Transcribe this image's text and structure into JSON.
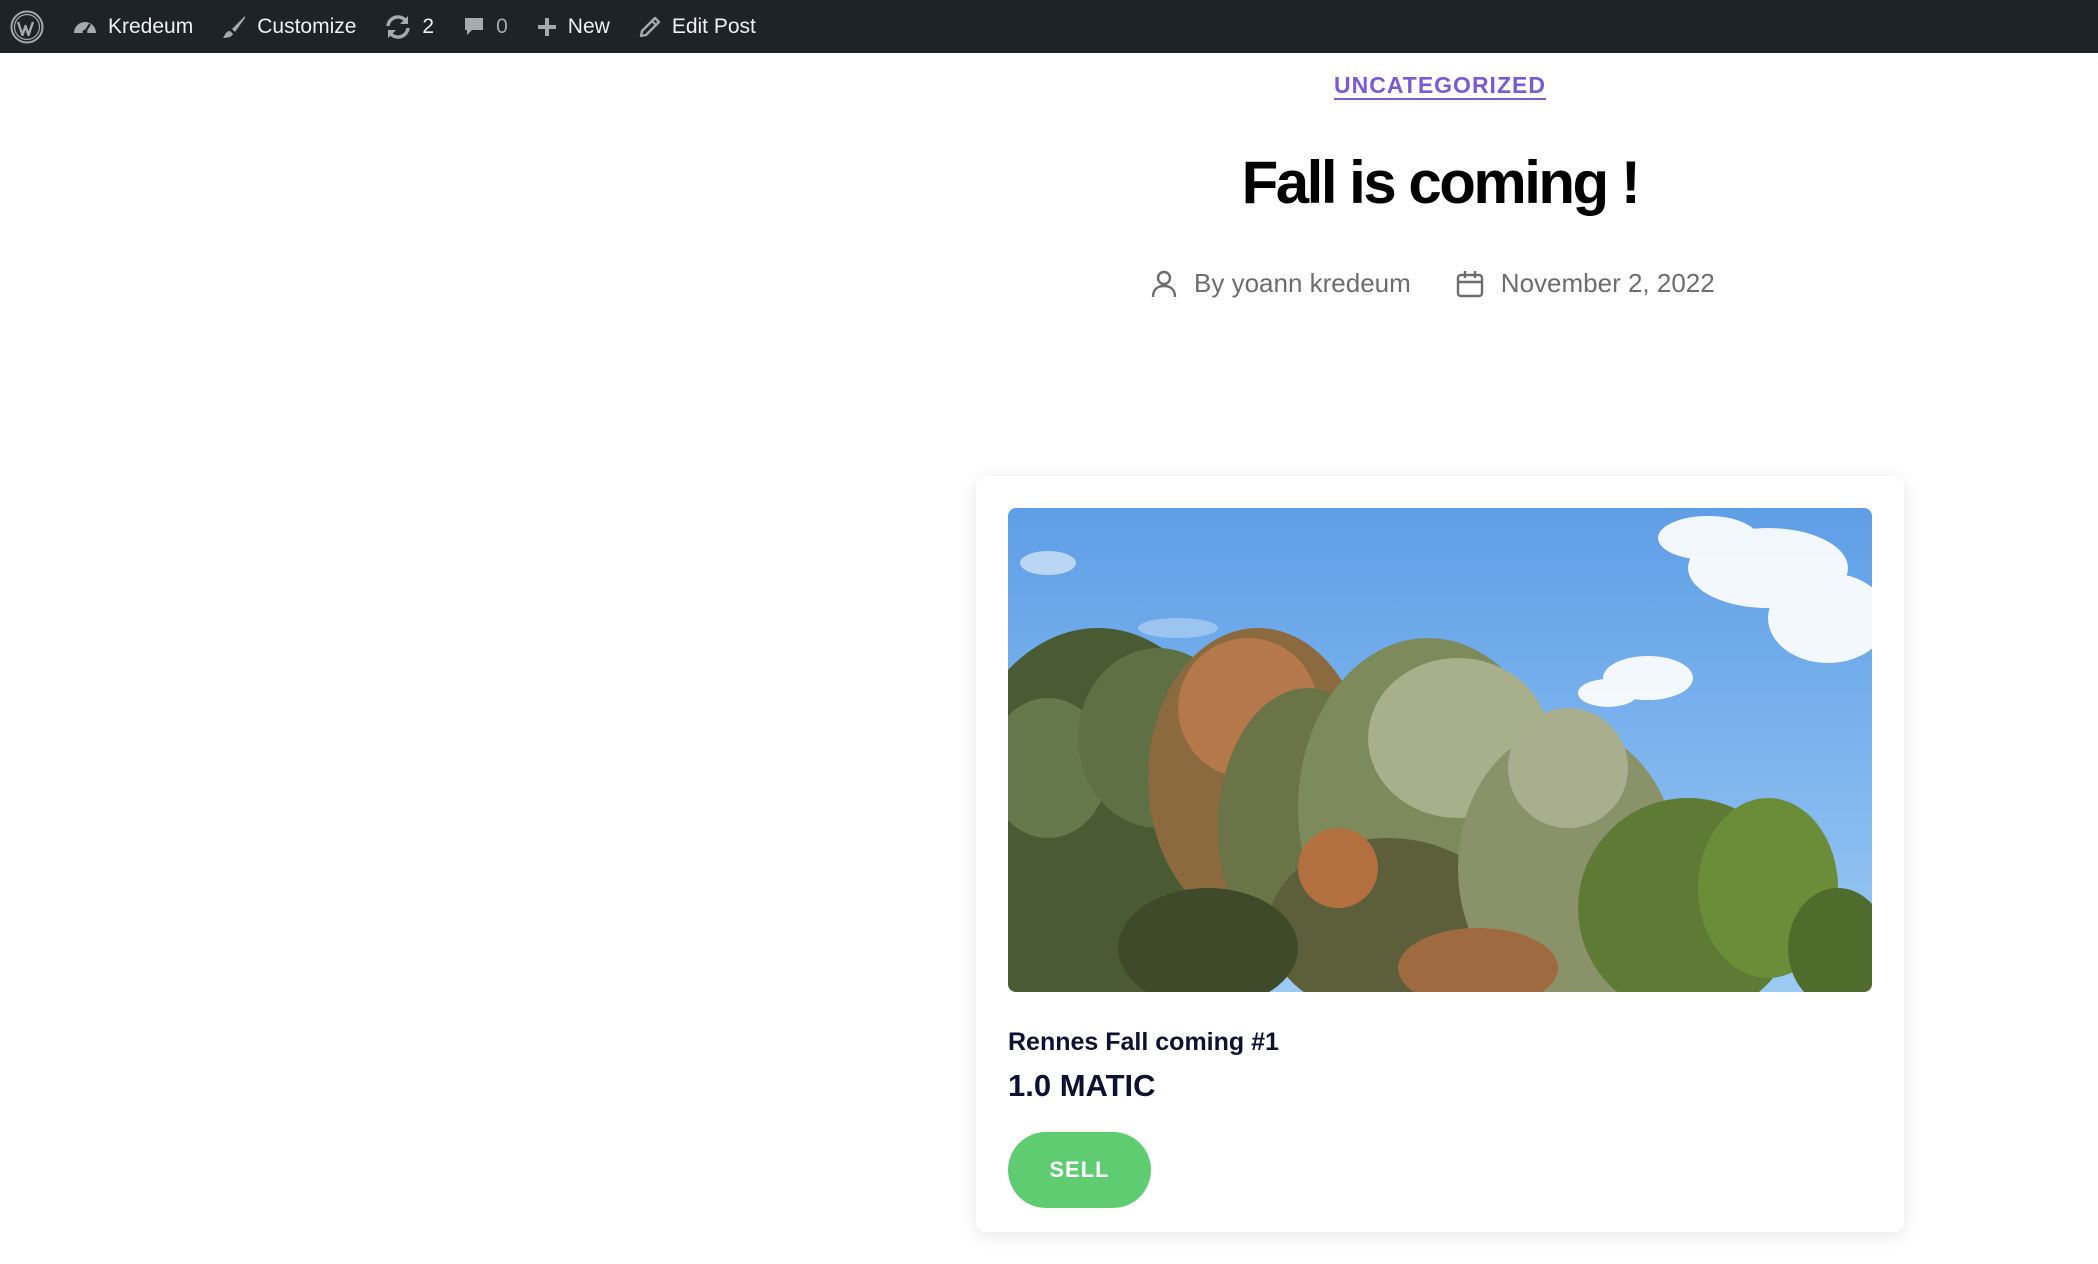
{
  "admin_bar": {
    "wp_logo_icon": "wordpress-logo-icon",
    "site": {
      "icon": "dashboard-icon",
      "label": "Kredeum"
    },
    "customize": {
      "icon": "brush-icon",
      "label": "Customize"
    },
    "updates": {
      "icon": "updates-icon",
      "count": "2"
    },
    "comments": {
      "icon": "comment-icon",
      "count": "0"
    },
    "new": {
      "icon": "plus-icon",
      "label": "New"
    },
    "edit": {
      "icon": "pencil-icon",
      "label": "Edit Post"
    },
    "colors": {
      "background": "#1d2327",
      "text": "#f0f0f1",
      "dim": "#a7aaad"
    }
  },
  "post": {
    "category": "UNCATEGORIZED",
    "title": "Fall is coming !",
    "author": "By yoann kredeum",
    "date": "November 2, 2022",
    "author_icon": "user-icon",
    "date_icon": "calendar-icon",
    "colors": {
      "category": "#7b5ad6",
      "meta": "#6d6d6d"
    }
  },
  "nft_card": {
    "image_alt": "trees with autumn leaves under a blue sky",
    "name": "Rennes Fall coming #1",
    "price": "1.0 MATIC",
    "button_label": "SELL",
    "colors": {
      "button": "#60cc72",
      "text": "#0f1130"
    }
  }
}
